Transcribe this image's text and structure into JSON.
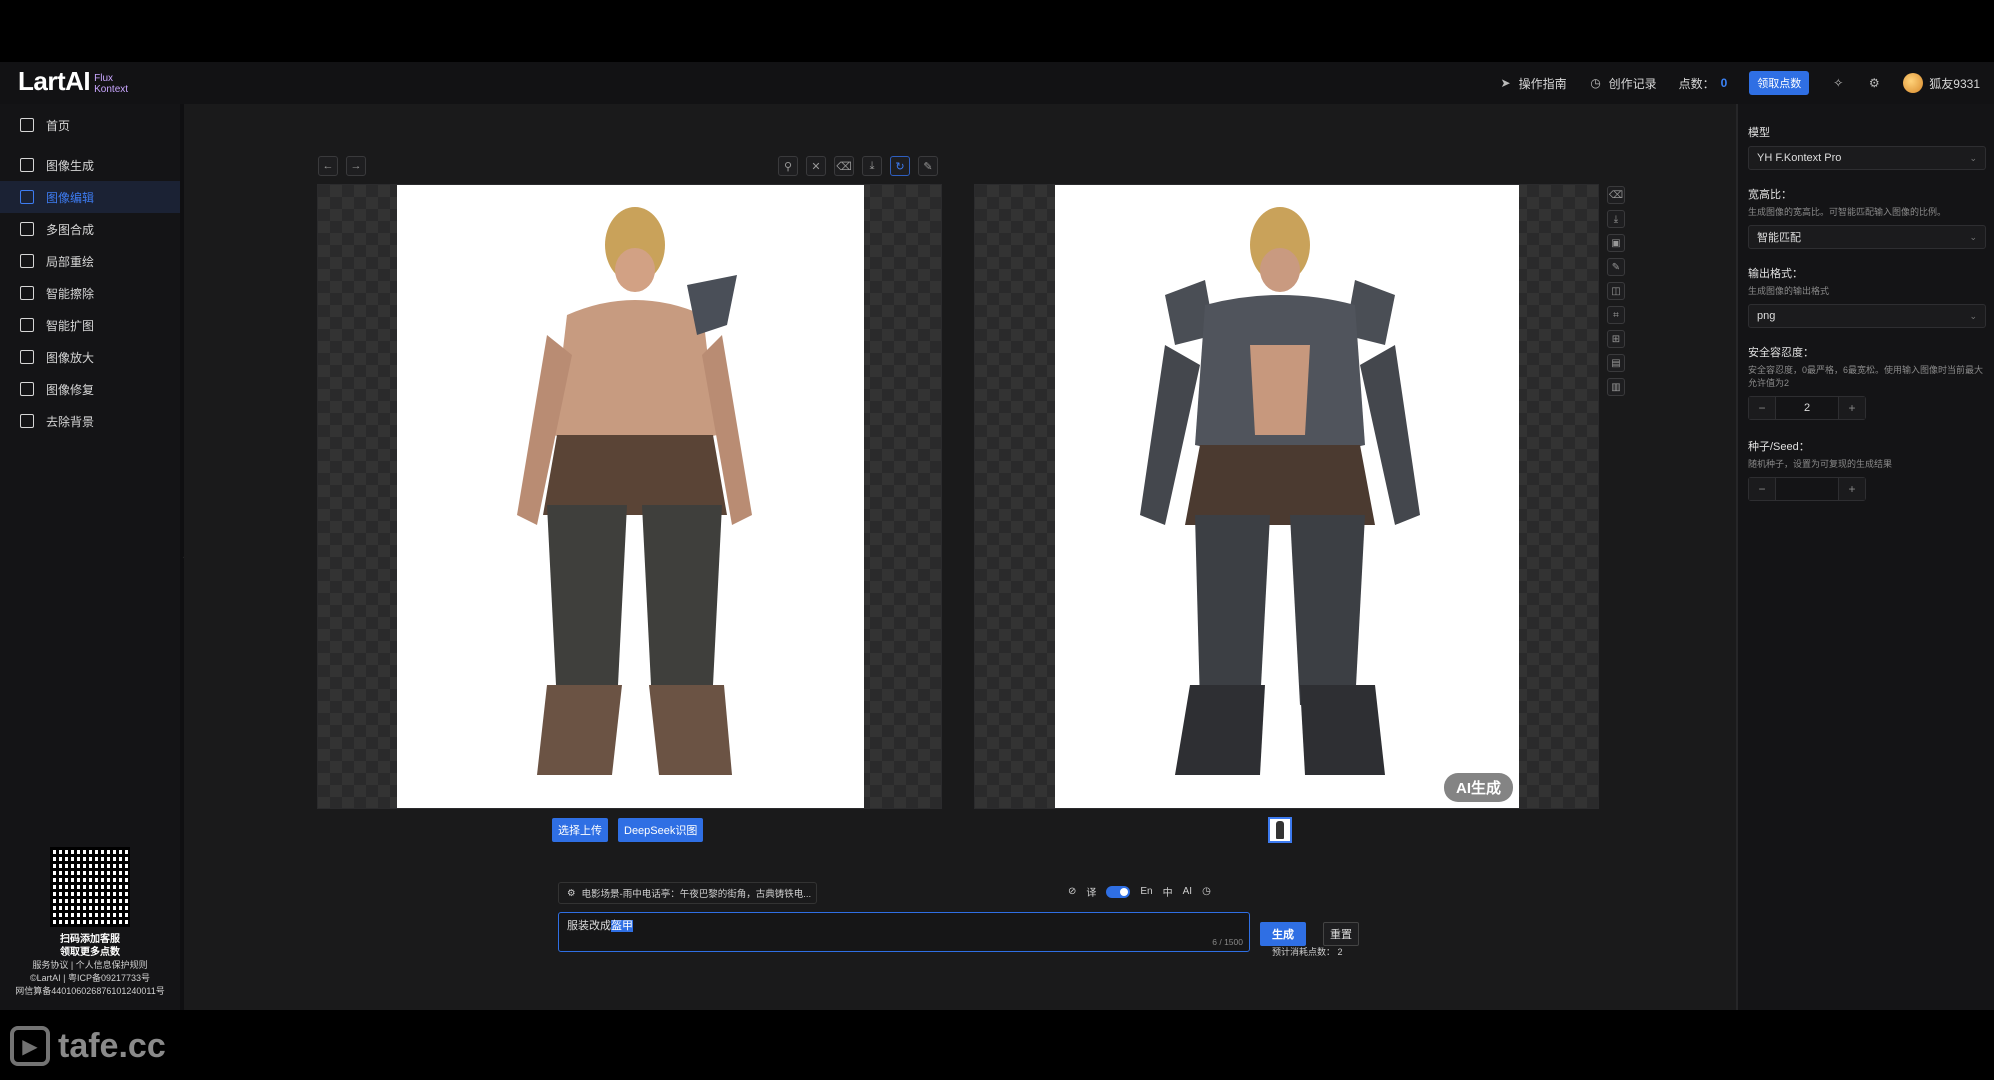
{
  "header": {
    "logo": "LartAI",
    "logo_sub_1": "Flux",
    "logo_sub_2": "Kontext",
    "guide": "操作指南",
    "history": "创作记录",
    "points_label": "点数：",
    "points_value": "0",
    "claim_points": "领取点数",
    "username": "狐友9331"
  },
  "sidebar": {
    "items": [
      {
        "label": "首页"
      },
      {
        "label": "图像生成"
      },
      {
        "label": "图像编辑"
      },
      {
        "label": "多图合成"
      },
      {
        "label": "局部重绘"
      },
      {
        "label": "智能擦除"
      },
      {
        "label": "智能扩图"
      },
      {
        "label": "图像放大"
      },
      {
        "label": "图像修复"
      },
      {
        "label": "去除背景"
      }
    ],
    "active_index": 2,
    "qr_title": "扫码添加客服",
    "qr_sub": "领取更多点数",
    "links": "服务协议 | 个人信息保护规则",
    "copyright": "©LartAI | 粤ICP备09217733号",
    "police": "网信算备440106026876101240011号"
  },
  "editor": {
    "upload_button": "选择上传",
    "deepseek_button": "DeepSeek识图",
    "ai_badge": "AI生成",
    "preset": "电影场景-雨中电话亭：午夜巴黎的街角，古典铸铁电...",
    "translate_label": "译",
    "lang_en": "En",
    "lang_zh": "中",
    "lang_ai": "AI",
    "prompt_prefix": "服装改成",
    "prompt_highlight": "盔甲",
    "counter": "6 / 1500",
    "generate": "生成",
    "reset": "重置",
    "cost_label": "预计消耗点数：",
    "cost_value": "2"
  },
  "settings": {
    "model_label": "模型",
    "model_value": "YH F.Kontext Pro",
    "ratio_label": "宽高比：",
    "ratio_desc": "生成图像的宽高比。可智能匹配输入图像的比例。",
    "ratio_value": "智能匹配",
    "format_label": "输出格式：",
    "format_desc": "生成图像的输出格式",
    "format_value": "png",
    "safety_label": "安全容忍度：",
    "safety_desc": "安全容忍度，0最严格，6最宽松。使用输入图像时当前最大允许值为2",
    "safety_value": "2",
    "seed_label": "种子/Seed：",
    "seed_desc": "随机种子，设置为可复现的生成结果",
    "seed_value": ""
  },
  "watermark": "tafe.cc",
  "colors": {
    "accent": "#2f6fe4",
    "background": "#1a1a1b",
    "sidebar": "#141416"
  }
}
